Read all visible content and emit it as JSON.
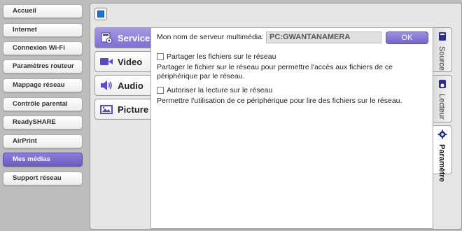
{
  "nav": {
    "items": [
      {
        "label": "Accueil"
      },
      {
        "label": "Internet"
      },
      {
        "label": "Connexion Wi-Fi"
      },
      {
        "label": "Paramètres routeur"
      },
      {
        "label": "Mappage réseau"
      },
      {
        "label": "Contrôle parental"
      },
      {
        "label": "ReadySHARE"
      },
      {
        "label": "AirPrint"
      },
      {
        "label": "Mes médias",
        "active": true
      },
      {
        "label": "Support réseau"
      }
    ]
  },
  "media_tabs": [
    {
      "label": "Service",
      "icon": "server-icon",
      "active": true
    },
    {
      "label": "Video",
      "icon": "video-camera-icon"
    },
    {
      "label": "Audio",
      "icon": "speaker-icon"
    },
    {
      "label": "Picture",
      "icon": "picture-icon"
    }
  ],
  "content": {
    "server_name_label": "Mon nom de serveur multimédia:",
    "server_name_value": "PC:GWANTANAMERA",
    "ok_label": "OK",
    "share_checkbox_label": "Partager les fichiers sur le réseau",
    "share_checked": false,
    "share_description": "Partager le fichier sur le réseau pour permettre l'accès aux fichiers de ce périphérique par le réseau.",
    "playback_checkbox_label": "Autoriser la lecture sur le réseau",
    "playback_checked": false,
    "playback_description": "Permettre l'utilisation de ce périphérique pour lire des fichiers sur le réseau."
  },
  "side_tabs": [
    {
      "label": "Source",
      "icon": "database-icon"
    },
    {
      "label": "Lecteur",
      "icon": "player-icon"
    },
    {
      "label": "Paramètre",
      "icon": "gear-icon",
      "active": true
    }
  ],
  "colors": {
    "accent": "#7467cc",
    "blue_square": "#1e74d6"
  }
}
